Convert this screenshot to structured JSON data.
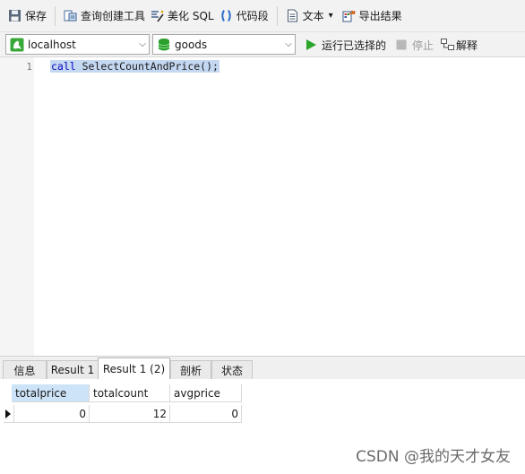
{
  "toolbar": {
    "save": "保存",
    "query_builder": "查询创建工具",
    "beautify_sql": "美化 SQL",
    "code_snippet": "代码段",
    "text": "文本",
    "text_arrow": "▾",
    "export": "导出结果"
  },
  "connection": {
    "selected": "localhost",
    "arrow": "⌵"
  },
  "database": {
    "selected": "goods",
    "arrow": "⌵"
  },
  "actions": {
    "run_selected": "运行已选择的",
    "stop": "停止",
    "explain": "解释"
  },
  "editor": {
    "line_number": "1",
    "keyword": "call",
    "statement": " SelectCountAndPrice();"
  },
  "result_tabs": [
    {
      "label": "信息"
    },
    {
      "label": "Result 1"
    },
    {
      "label": "Result 1 (2)"
    },
    {
      "label": "剖析"
    },
    {
      "label": "状态"
    }
  ],
  "grid": {
    "columns": [
      "totalprice",
      "totalcount",
      "avgprice"
    ],
    "rows": [
      [
        "0",
        "12",
        "0"
      ]
    ]
  },
  "watermark": "CSDN @我的天才女友",
  "colors": {
    "selection": "#c5d8f2",
    "keyword": "#0000c0",
    "run_green": "#2aa52a",
    "db_green": "#29a329"
  }
}
